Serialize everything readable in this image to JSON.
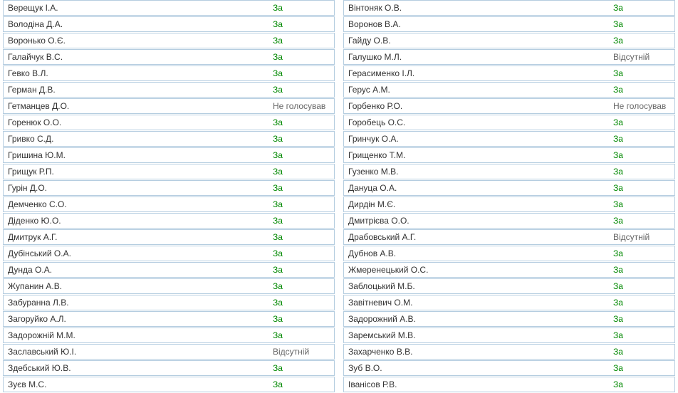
{
  "columns": [
    [
      {
        "name": "Верещук І.А.",
        "vote": "За",
        "kind": "for"
      },
      {
        "name": "Володіна Д.А.",
        "vote": "За",
        "kind": "for"
      },
      {
        "name": "Воронько О.Є.",
        "vote": "За",
        "kind": "for"
      },
      {
        "name": "Галайчук В.С.",
        "vote": "За",
        "kind": "for"
      },
      {
        "name": "Гевко В.Л.",
        "vote": "За",
        "kind": "for"
      },
      {
        "name": "Герман Д.В.",
        "vote": "За",
        "kind": "for"
      },
      {
        "name": "Гетманцев Д.О.",
        "vote": "Не голосував",
        "kind": "novote"
      },
      {
        "name": "Горенюк О.О.",
        "vote": "За",
        "kind": "for"
      },
      {
        "name": "Гривко С.Д.",
        "vote": "За",
        "kind": "for"
      },
      {
        "name": "Гришина Ю.М.",
        "vote": "За",
        "kind": "for"
      },
      {
        "name": "Грищук Р.П.",
        "vote": "За",
        "kind": "for"
      },
      {
        "name": "Гурін Д.О.",
        "vote": "За",
        "kind": "for"
      },
      {
        "name": "Демченко С.О.",
        "vote": "За",
        "kind": "for"
      },
      {
        "name": "Діденко Ю.О.",
        "vote": "За",
        "kind": "for"
      },
      {
        "name": "Дмитрук А.Г.",
        "vote": "За",
        "kind": "for"
      },
      {
        "name": "Дубінський О.А.",
        "vote": "За",
        "kind": "for"
      },
      {
        "name": "Дунда О.А.",
        "vote": "За",
        "kind": "for"
      },
      {
        "name": "Жупанин А.В.",
        "vote": "За",
        "kind": "for"
      },
      {
        "name": "Забуранна Л.В.",
        "vote": "За",
        "kind": "for"
      },
      {
        "name": "Загоруйко А.Л.",
        "vote": "За",
        "kind": "for"
      },
      {
        "name": "Задорожній М.М.",
        "vote": "За",
        "kind": "for"
      },
      {
        "name": "Заславський Ю.І.",
        "vote": "Відсутній",
        "kind": "absent"
      },
      {
        "name": "Здебський Ю.В.",
        "vote": "За",
        "kind": "for"
      },
      {
        "name": "Зуєв М.С.",
        "vote": "За",
        "kind": "for"
      }
    ],
    [
      {
        "name": "Вінтоняк О.В.",
        "vote": "За",
        "kind": "for"
      },
      {
        "name": "Воронов В.А.",
        "vote": "За",
        "kind": "for"
      },
      {
        "name": "Гайду О.В.",
        "vote": "За",
        "kind": "for"
      },
      {
        "name": "Галушко М.Л.",
        "vote": "Відсутній",
        "kind": "absent"
      },
      {
        "name": "Герасименко І.Л.",
        "vote": "За",
        "kind": "for"
      },
      {
        "name": "Герус А.М.",
        "vote": "За",
        "kind": "for"
      },
      {
        "name": "Горбенко Р.О.",
        "vote": "Не голосував",
        "kind": "novote"
      },
      {
        "name": "Горобець О.С.",
        "vote": "За",
        "kind": "for"
      },
      {
        "name": "Гринчук О.А.",
        "vote": "За",
        "kind": "for"
      },
      {
        "name": "Грищенко Т.М.",
        "vote": "За",
        "kind": "for"
      },
      {
        "name": "Гузенко М.В.",
        "vote": "За",
        "kind": "for"
      },
      {
        "name": "Дануца О.А.",
        "vote": "За",
        "kind": "for"
      },
      {
        "name": "Дирдін М.Є.",
        "vote": "За",
        "kind": "for"
      },
      {
        "name": "Дмитрієва О.О.",
        "vote": "За",
        "kind": "for"
      },
      {
        "name": "Драбовський А.Г.",
        "vote": "Відсутній",
        "kind": "absent"
      },
      {
        "name": "Дубнов А.В.",
        "vote": "За",
        "kind": "for"
      },
      {
        "name": "Жмеренецький О.С.",
        "vote": "За",
        "kind": "for"
      },
      {
        "name": "Заблоцький М.Б.",
        "vote": "За",
        "kind": "for"
      },
      {
        "name": "Завітневич О.М.",
        "vote": "За",
        "kind": "for"
      },
      {
        "name": "Задорожний А.В.",
        "vote": "За",
        "kind": "for"
      },
      {
        "name": "Заремський М.В.",
        "vote": "За",
        "kind": "for"
      },
      {
        "name": "Захарченко В.В.",
        "vote": "За",
        "kind": "for"
      },
      {
        "name": "Зуб В.О.",
        "vote": "За",
        "kind": "for"
      },
      {
        "name": "Іванісов Р.В.",
        "vote": "За",
        "kind": "for"
      }
    ]
  ]
}
